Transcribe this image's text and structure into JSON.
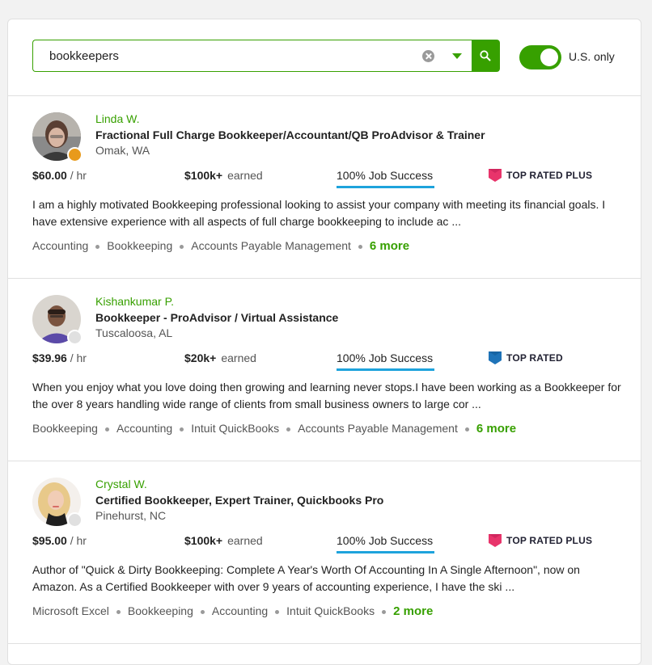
{
  "search": {
    "value": "bookkeepers",
    "us_only_label": "U.S. only",
    "us_only_enabled": true
  },
  "colors": {
    "brand_green": "#37a000",
    "job_success_bar": "#1ea3dc",
    "top_rated_plus": "#e8346b",
    "top_rated": "#1e73b8",
    "status_away": "#e89a1c",
    "status_offline": "#e0e0e0"
  },
  "results": [
    {
      "name": "Linda W.",
      "title": "Fractional Full Charge Bookkeeper/Accountant/QB ProAdvisor & Trainer",
      "location": "Omak, WA",
      "rate_amount": "$60.00",
      "rate_unit": "/ hr",
      "earned_amount": "$100k+",
      "earned_label": "earned",
      "job_success": "100% Job Success",
      "badge": "TOP RATED PLUS",
      "badge_icon": "top-rated-plus-icon",
      "status": "away",
      "description": "I am a highly motivated Bookkeeping professional looking to assist your company with meeting its financial goals. I have extensive experience with all aspects of full charge bookkeeping to include ac ...",
      "skills": [
        "Accounting",
        "Bookkeeping",
        "Accounts Payable Management"
      ],
      "more": "6 more"
    },
    {
      "name": "Kishankumar P.",
      "title": "Bookkeeper - ProAdvisor / Virtual Assistance",
      "location": "Tuscaloosa, AL",
      "rate_amount": "$39.96",
      "rate_unit": "/ hr",
      "earned_amount": "$20k+",
      "earned_label": "earned",
      "job_success": "100% Job Success",
      "badge": "TOP RATED",
      "badge_icon": "top-rated-icon",
      "status": "offline",
      "description": "When you enjoy what you love doing then growing and learning never stops.I have been working as a Bookkeeper for the over 8 years handling wide range of clients from small business owners to large cor ...",
      "skills": [
        "Bookkeeping",
        "Accounting",
        "Intuit QuickBooks",
        "Accounts Payable Management"
      ],
      "more": "6 more"
    },
    {
      "name": "Crystal W.",
      "title": "Certified Bookkeeper, Expert Trainer, Quickbooks Pro",
      "location": "Pinehurst, NC",
      "rate_amount": "$95.00",
      "rate_unit": "/ hr",
      "earned_amount": "$100k+",
      "earned_label": "earned",
      "job_success": "100% Job Success",
      "badge": "TOP RATED PLUS",
      "badge_icon": "top-rated-plus-icon",
      "status": "offline",
      "description": "Author of \"Quick & Dirty Bookkeeping: Complete A Year's Worth Of Accounting In A Single Afternoon\", now on Amazon. As a Certified Bookkeeper with over 9 years of accounting experience, I have the ski ...",
      "skills": [
        "Microsoft Excel",
        "Bookkeeping",
        "Accounting",
        "Intuit QuickBooks"
      ],
      "more": "2 more"
    }
  ]
}
